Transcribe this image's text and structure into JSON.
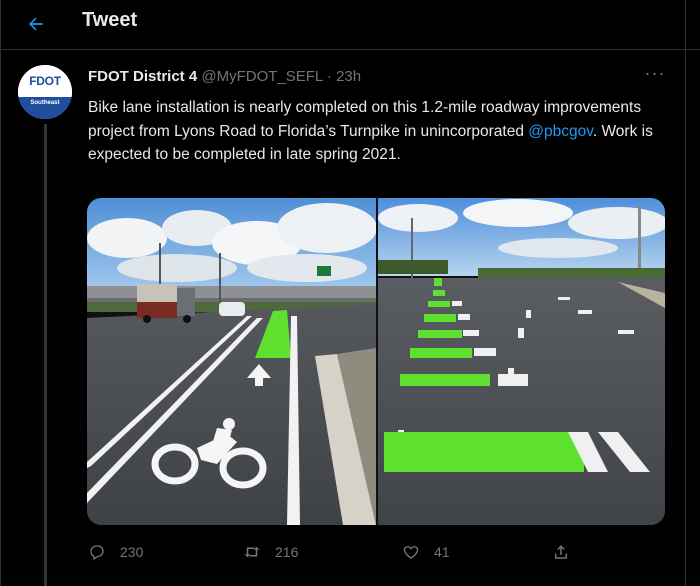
{
  "header": {
    "title": "Tweet",
    "back_icon": "arrow-left-icon"
  },
  "tweet": {
    "author_name": "FDOT District 4",
    "author_handle": "@MyFDOT_SEFL",
    "separator": " · ",
    "time": "23h",
    "avatar": {
      "logo_text": "FDOT",
      "sub_text": "Southeast"
    },
    "text_part1": "Bike lane installation is nearly completed on this 1.2-mile roadway improvements project from Lyons Road to Florida’s Turnpike in unincorporated ",
    "mention": "@pbcgov",
    "text_part2": ". Work is expected to be completed in late spring 2021.",
    "more_label": "···"
  },
  "actions": {
    "replies": "230",
    "retweets": "216",
    "likes": "41"
  },
  "colors": {
    "background": "#000000",
    "text": "#e7e9ea",
    "muted": "#71767b",
    "accent": "#1d9bf0",
    "bike_lane_green": "#5ee02e"
  }
}
